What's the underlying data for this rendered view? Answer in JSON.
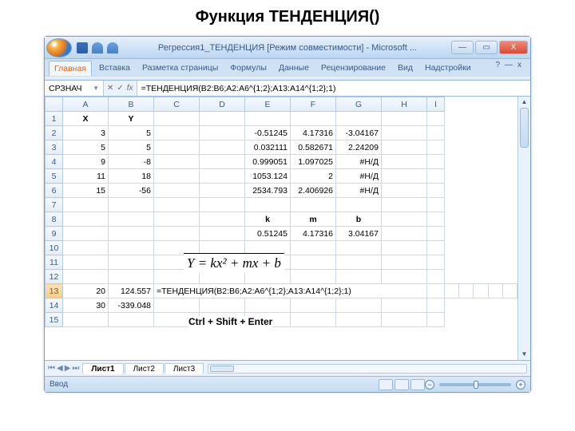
{
  "page_heading": "Функция ТЕНДЕНЦИЯ()",
  "window": {
    "title": "Регрессия1_ТЕНДЕНЦИЯ [Режим совместимости] - Microsoft ...",
    "min": "—",
    "max": "▭",
    "close": "X"
  },
  "ribbon": {
    "tabs": [
      "Главная",
      "Вставка",
      "Разметка страницы",
      "Формулы",
      "Данные",
      "Рецензирование",
      "Вид",
      "Надстройки"
    ],
    "help": "?",
    "mdi_min": "—",
    "mdi_close": "x"
  },
  "formula_bar": {
    "name_box": "СРЗНАЧ",
    "cancel": "✕",
    "enter": "✓",
    "fx": "fx",
    "formula": "=ТЕНДЕНЦИЯ(B2:B6;A2:A6^{1;2};A13:A14^{1;2};1)"
  },
  "columns": [
    "",
    "A",
    "B",
    "C",
    "D",
    "E",
    "F",
    "G",
    "H",
    "I"
  ],
  "narrow_col": "I",
  "rows": [
    {
      "n": "1",
      "cells": {
        "A": "X",
        "B": "Y"
      },
      "bold": [
        "A",
        "B"
      ]
    },
    {
      "n": "2",
      "cells": {
        "A": "3",
        "B": "5",
        "E": "-0.51245",
        "F": "4.17316",
        "G": "-3.04167"
      }
    },
    {
      "n": "3",
      "cells": {
        "A": "5",
        "B": "5",
        "E": "0.032111",
        "F": "0.582671",
        "G": "2.24209"
      }
    },
    {
      "n": "4",
      "cells": {
        "A": "9",
        "B": "-8",
        "E": "0.999051",
        "F": "1.097025",
        "G": "#Н/Д"
      }
    },
    {
      "n": "5",
      "cells": {
        "A": "11",
        "B": "18",
        "E": "1053.124",
        "F": "2",
        "G": "#Н/Д"
      }
    },
    {
      "n": "6",
      "cells": {
        "A": "15",
        "B": "-56",
        "E": "2534.793",
        "F": "2.406926",
        "G": "#Н/Д"
      }
    },
    {
      "n": "7",
      "cells": {}
    },
    {
      "n": "8",
      "cells": {
        "E": "k",
        "F": "m",
        "G": "b"
      },
      "bold": [
        "E",
        "F",
        "G"
      ]
    },
    {
      "n": "9",
      "cells": {
        "E": "0.51245",
        "F": "4.17316",
        "G": "3.04167"
      }
    },
    {
      "n": "10",
      "cells": {}
    },
    {
      "n": "11",
      "cells": {}
    },
    {
      "n": "12",
      "cells": {}
    },
    {
      "n": "13",
      "cells": {
        "A": "20",
        "B": "124.557",
        "C": "=ТЕНДЕНЦИЯ(B2:B6;A2:A6^{1;2};A13:A14^{1;2};1)"
      },
      "editing": "C",
      "sel": true
    },
    {
      "n": "14",
      "cells": {
        "A": "30",
        "B": "-339.048"
      }
    },
    {
      "n": "15",
      "cells": {}
    }
  ],
  "equation": "Y = kx² + mx + b",
  "kbd": "Ctrl + Shift + Enter",
  "sheet_tabs": {
    "tabs": [
      "Лист1",
      "Лист2",
      "Лист3"
    ],
    "active": "Лист1"
  },
  "status": {
    "mode": "Ввод"
  }
}
